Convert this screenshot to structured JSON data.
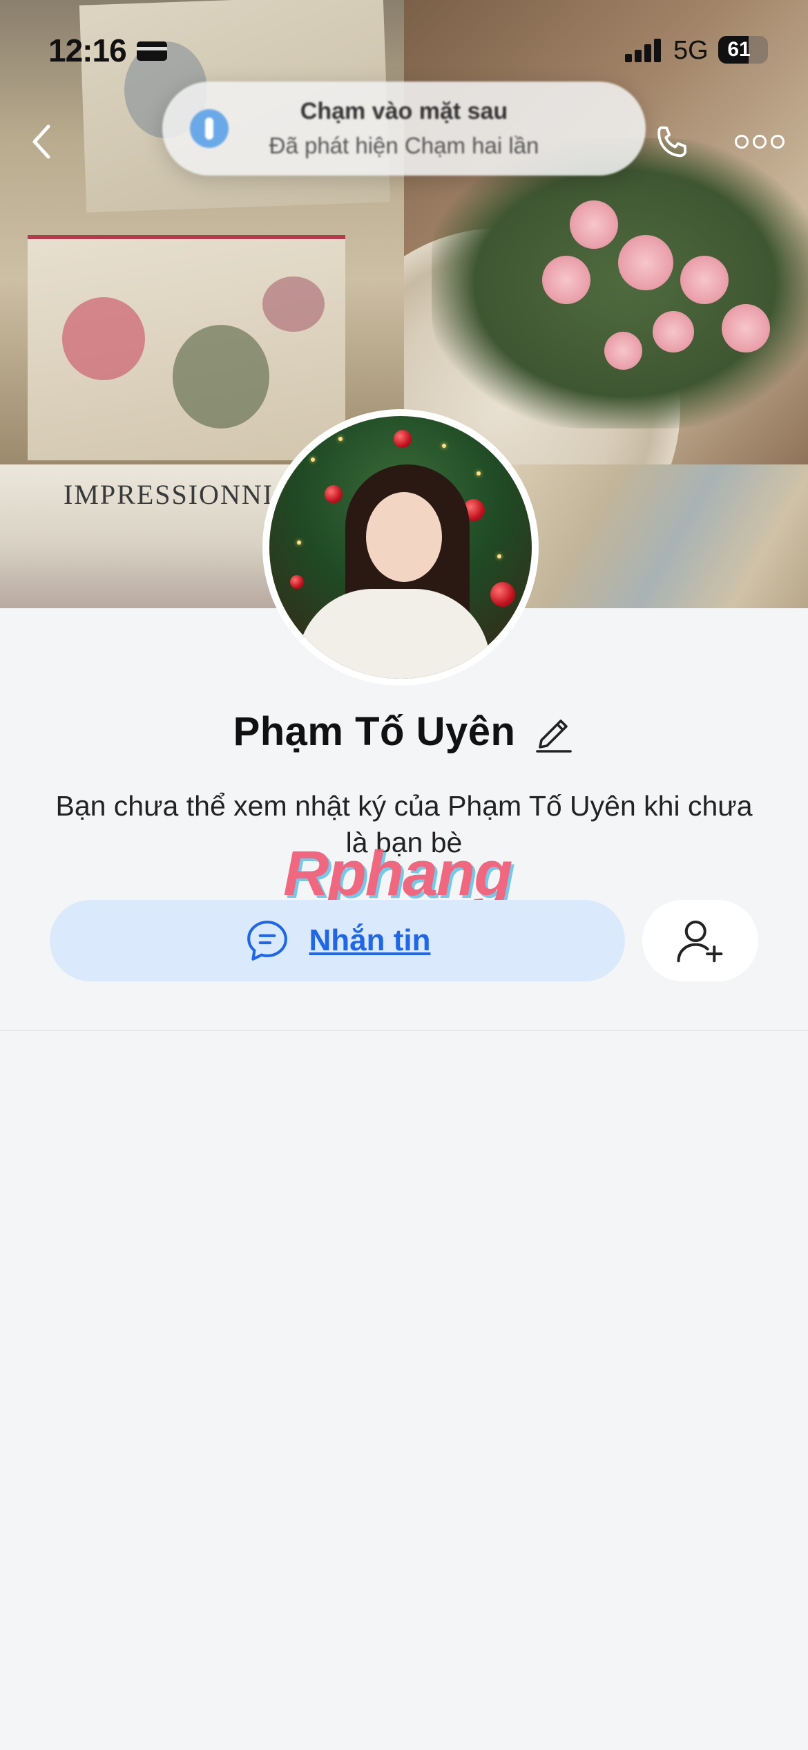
{
  "status_bar": {
    "time": "12:16",
    "network": "5G",
    "battery": "61"
  },
  "toast": {
    "title": "Chạm vào mặt sau",
    "subtitle": "Đã phát hiện Chạm hai lần"
  },
  "cover": {
    "book_title": "IMPRESSIONNISM"
  },
  "profile": {
    "name": "Phạm Tố Uyên",
    "privacy_note": "Bạn chưa thể xem nhật ký của Phạm Tố Uyên khi chưa là bạn bè"
  },
  "watermark": "Rphang",
  "actions": {
    "message_label": "Nhắn tin"
  },
  "colors": {
    "accent": "#1f67e6",
    "message_button_bg": "#dbe9fc",
    "page_bg": "#f4f5f7"
  },
  "icons": [
    "card-icon",
    "signal-icon",
    "battery-icon",
    "back-chevron-icon",
    "phone-icon",
    "more-icon",
    "pencil-icon",
    "chat-bubble-icon",
    "add-friend-icon"
  ]
}
